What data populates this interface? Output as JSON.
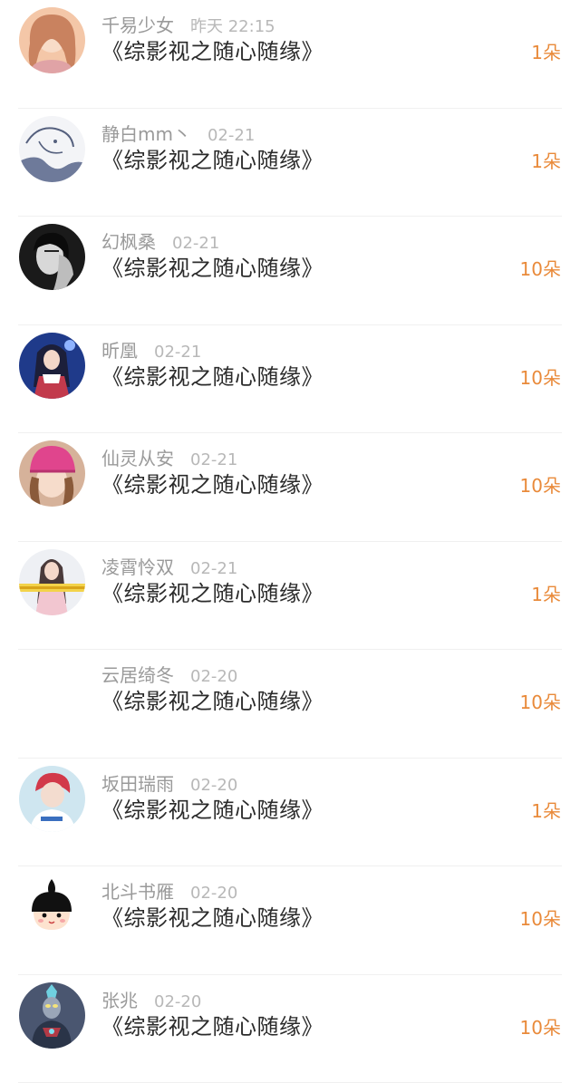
{
  "entries": [
    {
      "name": "千易少女",
      "time": "昨天 22:15",
      "title": "《综影视之随心随缘》",
      "count": "1朵",
      "avatar": "girl-pink-hair-avatar"
    },
    {
      "name": "静白mm丶",
      "time": "02-21",
      "title": "《综影视之随心随缘》",
      "count": "1朵",
      "avatar": "line-sketch-avatar"
    },
    {
      "name": "幻枫桑",
      "time": "02-21",
      "title": "《综影视之随心随缘》",
      "count": "10朵",
      "avatar": "black-white-portrait-avatar"
    },
    {
      "name": "昕凰",
      "time": "02-21",
      "title": "《综影视之随心随缘》",
      "count": "10朵",
      "avatar": "anime-girl-avatar"
    },
    {
      "name": "仙灵从安",
      "time": "02-21",
      "title": "《综影视之随心随缘》",
      "count": "10朵",
      "avatar": "knit-hat-girl-avatar"
    },
    {
      "name": "凌霄怜双",
      "time": "02-21",
      "title": "《综影视之随心随缘》",
      "count": "1朵",
      "avatar": "girl-banner-avatar"
    },
    {
      "name": "云居绮冬",
      "time": "02-20",
      "title": "《综影视之随心随缘》",
      "count": "10朵",
      "avatar": ""
    },
    {
      "name": "坂田瑞雨",
      "time": "02-20",
      "title": "《综影视之随心随缘》",
      "count": "1朵",
      "avatar": "red-hair-boy-avatar"
    },
    {
      "name": "北斗书雁",
      "time": "02-20",
      "title": "《综影视之随心随缘》",
      "count": "10朵",
      "avatar": "cartoon-head-avatar"
    },
    {
      "name": "张兆",
      "time": "02-20",
      "title": "《综影视之随心随缘》",
      "count": "10朵",
      "avatar": "ultraman-avatar"
    }
  ]
}
